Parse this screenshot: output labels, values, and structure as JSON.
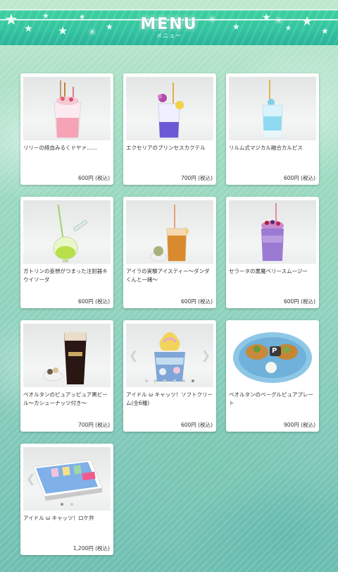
{
  "header": {
    "title": "MENU",
    "subtitle": "メニュー"
  },
  "menu": [
    {
      "name": "リリーの経血みるくドヤァ……",
      "price": "600円 (税込)"
    },
    {
      "name": "エクセリアのプリンセスカクテル",
      "price": "700円 (税込)"
    },
    {
      "name": "リルム式マジカル融合カルピス",
      "price": "600円 (税込)"
    },
    {
      "name": "ガトリンの妄想がつまった注射器キウイソーダ",
      "price": "600円 (税込)"
    },
    {
      "name": "アイラの実験アイスティー〜ダンダくんと一緒〜",
      "price": "600円 (税込)"
    },
    {
      "name": "セラータの悪魔ベリースムージー",
      "price": "600円 (税込)"
    },
    {
      "name": "ベオルタンのピュアッピュア黒ビール〜カシューナッツ付き〜",
      "price": "700円 (税込)"
    },
    {
      "name": "アイドル ω キャッツ！ソフトクリーム(全6種)",
      "price": "600円 (税込)"
    },
    {
      "name": "ベオルタンのベーグルピュアプレート",
      "price": "900円 (税込)"
    },
    {
      "name": "アイドル ω キャッツ！ロケ弁",
      "price": "1,200円 (税込)"
    }
  ],
  "colors": {
    "header": "#32c3a0",
    "card": "#ffffff",
    "text": "#333333"
  },
  "carousel": {
    "item_8_active_dot": 6,
    "item_8_dot_count": 6,
    "item_10_active_dot": 1,
    "item_10_dot_count": 2
  },
  "icons": [
    "star-icon",
    "sparkle-icon",
    "chevron-left-icon",
    "chevron-right-icon",
    "parking-sign-icon"
  ]
}
